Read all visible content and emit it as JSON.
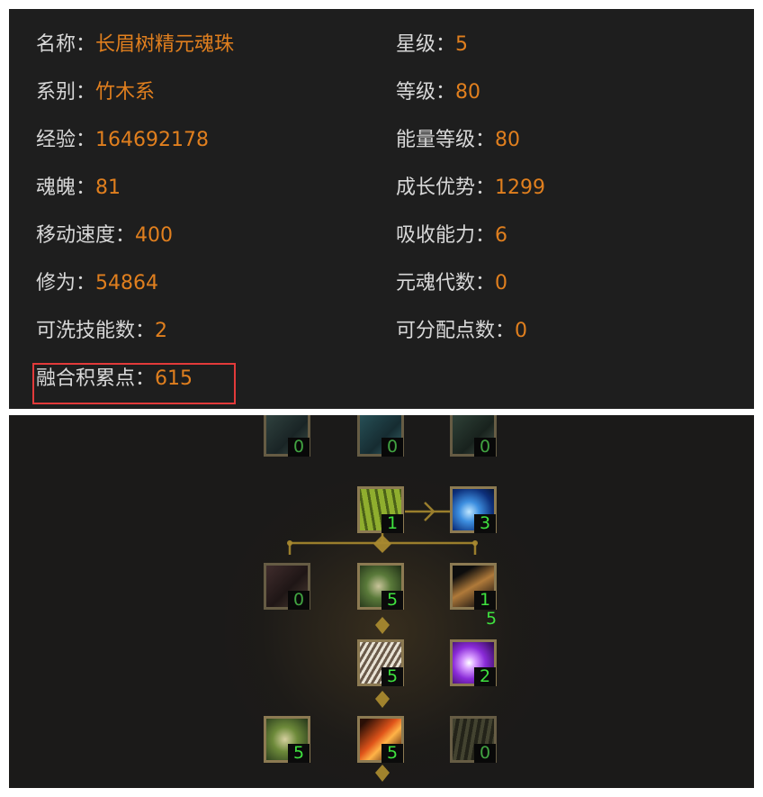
{
  "stats": {
    "left": [
      {
        "label": "名称：",
        "value": "长眉树精元魂珠"
      },
      {
        "label": "系别：",
        "value": "竹木系"
      },
      {
        "label": "经验：",
        "value": "164692178"
      },
      {
        "label": "魂魄：",
        "value": "81"
      },
      {
        "label": "移动速度：",
        "value": "400"
      },
      {
        "label": "修为：",
        "value": "54864"
      },
      {
        "label": "可洗技能数：",
        "value": "2"
      },
      {
        "label": "融合积累点：",
        "value": "615"
      }
    ],
    "right": [
      {
        "label": "星级：",
        "value": "5"
      },
      {
        "label": "等级：",
        "value": "80"
      },
      {
        "label": "能量等级：",
        "value": "80"
      },
      {
        "label": "成长优势：",
        "value": "1299"
      },
      {
        "label": "吸收能力：",
        "value": "6"
      },
      {
        "label": "元魂代数：",
        "value": "0"
      },
      {
        "label": "可分配点数：",
        "value": "0"
      }
    ]
  },
  "skill_tree": {
    "row1": [
      "0",
      "0",
      "0"
    ],
    "row2": [
      "1",
      "3"
    ],
    "row3": [
      "0",
      "5",
      "1"
    ],
    "row3_extra": "5",
    "row4": [
      "5",
      "2"
    ],
    "row5": [
      "5",
      "5",
      "0"
    ]
  },
  "colors": {
    "label": "#d8d8d8",
    "value": "#e07f1e",
    "level": "#3fe23f",
    "highlight": "#e23a3a",
    "frame": "#8c7a52"
  }
}
